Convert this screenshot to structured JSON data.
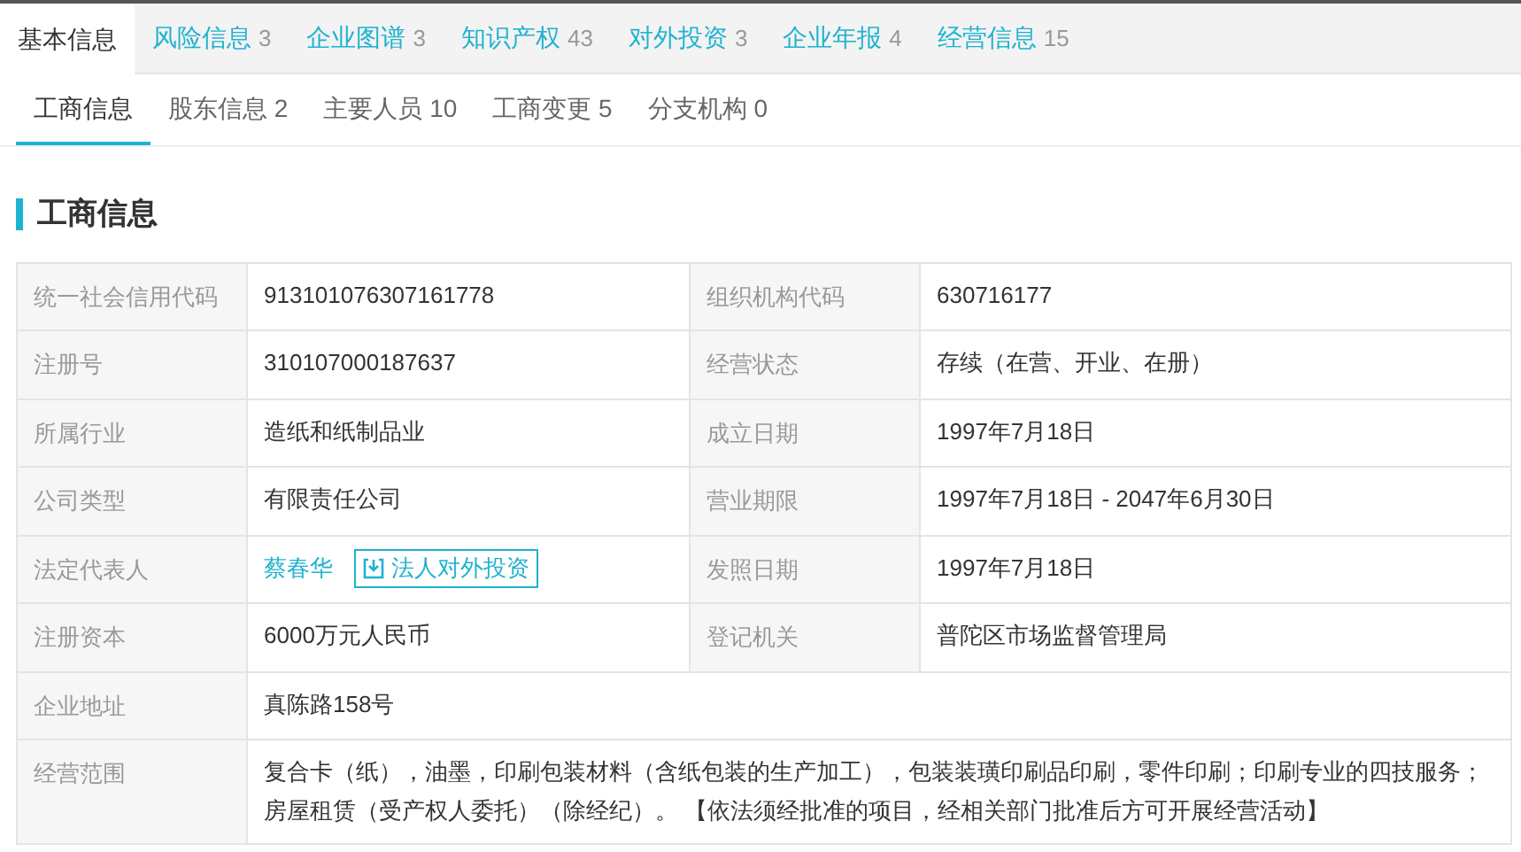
{
  "tabs": [
    {
      "label": "基本信息",
      "selected": true
    },
    {
      "label": "风险信息",
      "count": "3",
      "selected": false
    },
    {
      "label": "企业图谱",
      "count": "3",
      "selected": false
    },
    {
      "label": "知识产权",
      "count": "43",
      "selected": false
    },
    {
      "label": "对外投资",
      "count": "3",
      "selected": false
    },
    {
      "label": "企业年报",
      "count": "4",
      "selected": false
    },
    {
      "label": "经营信息",
      "count": "15",
      "selected": false
    }
  ],
  "subtabs": [
    {
      "label": "工商信息",
      "selected": true
    },
    {
      "label": "股东信息 2",
      "selected": false
    },
    {
      "label": "主要人员 10",
      "selected": false
    },
    {
      "label": "工商变更 5",
      "selected": false
    },
    {
      "label": "分支机构 0",
      "selected": false
    }
  ],
  "section_title": "工商信息",
  "table": {
    "rows": [
      [
        {
          "label": "统一社会信用代码",
          "kind": "text",
          "value": "913101076307161778"
        },
        {
          "label": "组织机构代码",
          "kind": "text",
          "value": "630716177"
        }
      ],
      [
        {
          "label": "注册号",
          "kind": "text",
          "value": "310107000187637"
        },
        {
          "label": "经营状态",
          "kind": "text",
          "value": "存续（在营、开业、在册）"
        }
      ],
      [
        {
          "label": "所属行业",
          "kind": "text",
          "value": "造纸和纸制品业"
        },
        {
          "label": "成立日期",
          "kind": "text",
          "value": "1997年7月18日"
        }
      ],
      [
        {
          "label": "公司类型",
          "kind": "text",
          "value": "有限责任公司"
        },
        {
          "label": "营业期限",
          "kind": "text",
          "value": "1997年7月18日 - 2047年6月30日"
        }
      ],
      [
        {
          "label": "法定代表人",
          "kind": "person",
          "value": "蔡春华",
          "action": "法人对外投资"
        },
        {
          "label": "发照日期",
          "kind": "text",
          "value": "1997年7月18日"
        }
      ],
      [
        {
          "label": "注册资本",
          "kind": "text",
          "value": "6000万元人民币"
        },
        {
          "label": "登记机关",
          "kind": "text",
          "value": "普陀区市场监督管理局"
        }
      ],
      [
        {
          "label": "企业地址",
          "kind": "text",
          "value": "真陈路158号"
        }
      ],
      [
        {
          "label": "经营范围",
          "kind": "text",
          "value": "复合卡（纸），油墨，印刷包装材料（含纸包装的生产加工），包装装璜印刷品印刷，零件印刷；印刷专业的四技服务；房屋租赁（受产权人委托）（除经纪）。 【依法须经批准的项目，经相关部门批准后方可开展经营活动】"
        }
      ]
    ]
  }
}
